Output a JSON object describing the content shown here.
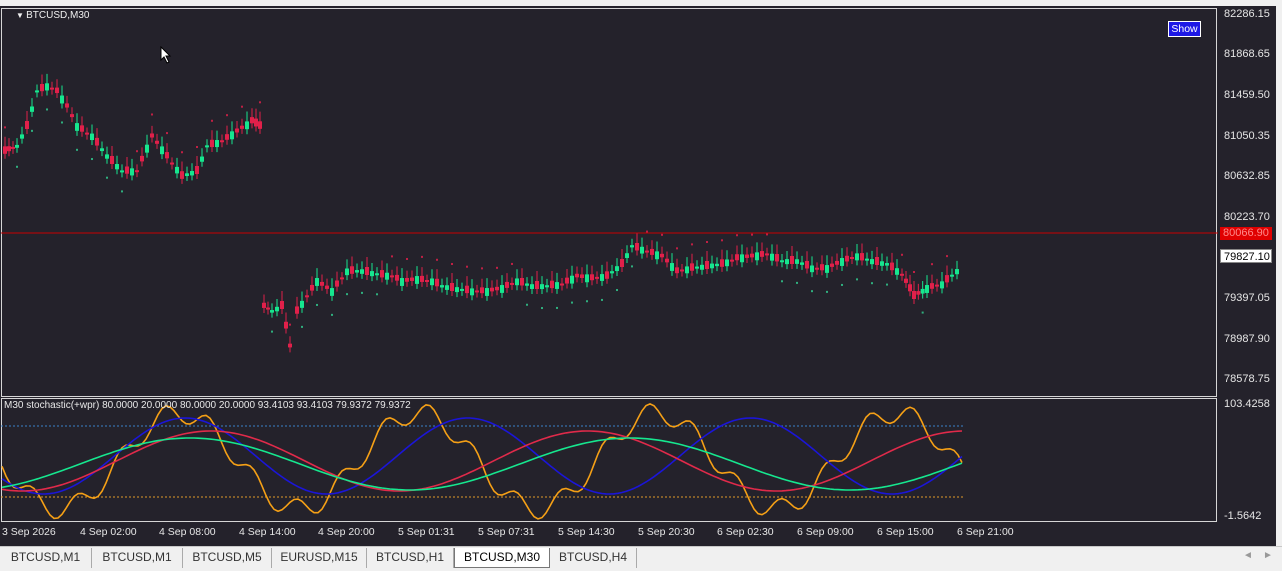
{
  "window": {
    "symbol_title": "BTCUSD,M30",
    "show_button": "Show"
  },
  "price_scale": [
    "82286.15",
    "81868.65",
    "81459.50",
    "81050.35",
    "80632.85",
    "80223.70",
    "79397.05",
    "78987.90",
    "78578.75"
  ],
  "price_tags": {
    "red_line": "80066.90",
    "current": "79827.10"
  },
  "indicator": {
    "title": "M30 stochastic(+wpr) 80.0000 20.0000 80.0000 20.0000 93.4103 93.4103 79.9372 79.9372",
    "scale_top": "103.4258",
    "scale_bottom": "-1.5642"
  },
  "time_axis": [
    "3 Sep 2026",
    "4 Sep 02:00",
    "4 Sep 08:00",
    "4 Sep 14:00",
    "4 Sep 20:00",
    "5 Sep 01:31",
    "5 Sep 07:31",
    "5 Sep 14:30",
    "5 Sep 20:30",
    "6 Sep 02:30",
    "6 Sep 09:00",
    "6 Sep 15:00",
    "6 Sep 21:00"
  ],
  "tabs": [
    {
      "label": "BTCUSD,M1",
      "active": false
    },
    {
      "label": "BTCUSD,M1",
      "active": false
    },
    {
      "label": "BTCUSD,M5",
      "active": false
    },
    {
      "label": "EURUSD,M15",
      "active": false
    },
    {
      "label": "BTCUSD,H1",
      "active": false
    },
    {
      "label": "BTCUSD,M30",
      "active": true
    },
    {
      "label": "BTCUSD,H4",
      "active": false
    }
  ],
  "colors": {
    "background": "#24222b",
    "bull": "#16e78f",
    "bear": "#e1204a",
    "blue_line": "#1b15d8",
    "orange_line": "#f5a016",
    "level_blue": "#3a82c8",
    "level_orange": "#e09a28",
    "price_line": "#c80000"
  }
}
